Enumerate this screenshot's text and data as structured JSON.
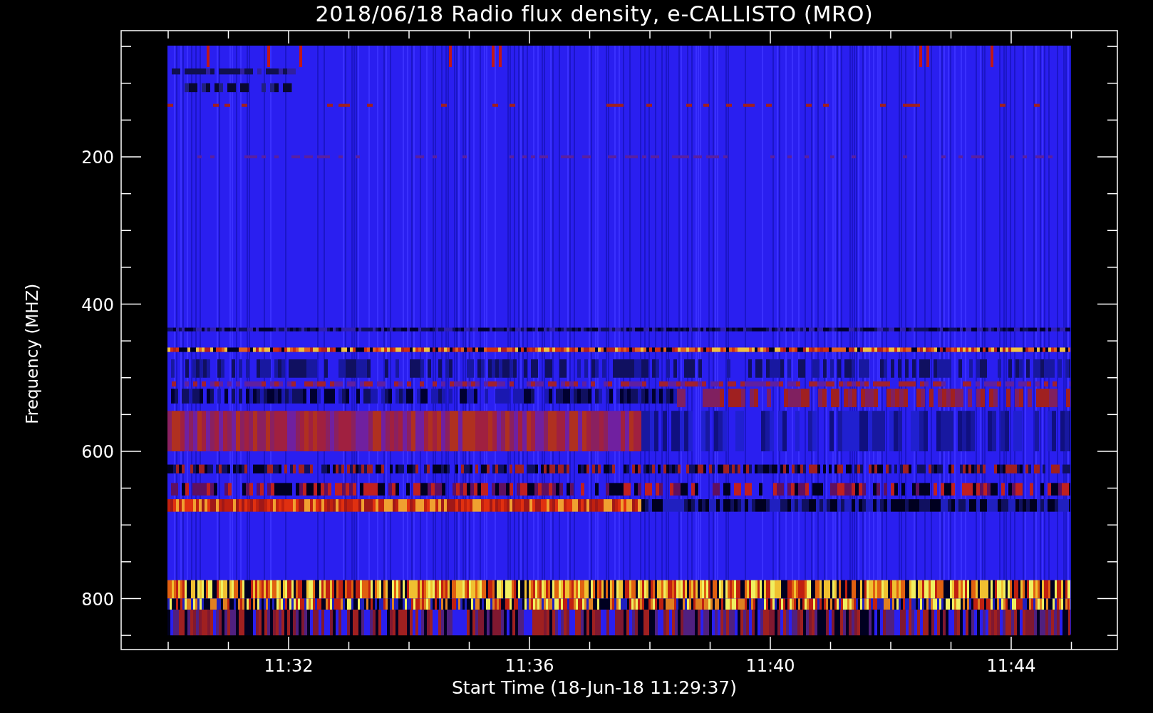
{
  "title": "2018/06/18  Radio flux density, e-CALLISTO (MRO)",
  "y_axis": {
    "label": "Frequency (MHZ)",
    "ticks": [
      "200",
      "400",
      "600",
      "800"
    ]
  },
  "x_axis": {
    "label": "Start Time (18-Jun-18 11:29:37)",
    "ticks": [
      "11:32",
      "11:36",
      "11:40",
      "11:44"
    ]
  }
}
